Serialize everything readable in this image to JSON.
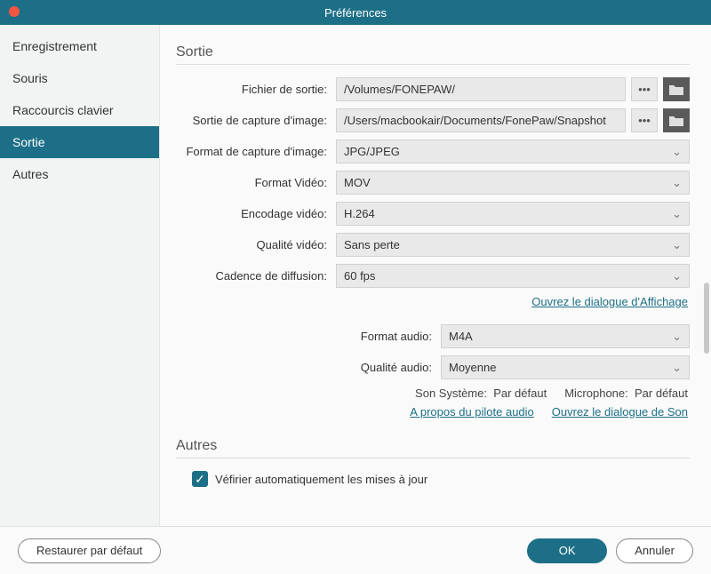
{
  "title": "Préférences",
  "sidebar": {
    "items": [
      {
        "label": "Enregistrement"
      },
      {
        "label": "Souris"
      },
      {
        "label": "Raccourcis clavier"
      },
      {
        "label": "Sortie",
        "active": true
      },
      {
        "label": "Autres"
      }
    ]
  },
  "sections": {
    "sortie_title": "Sortie",
    "autres_title": "Autres"
  },
  "labels": {
    "fichier_sortie": "Fichier de sortie:",
    "capture_image_sortie": "Sortie de capture d'image:",
    "format_capture": "Format de capture d'image:",
    "format_video": "Format Vidéo:",
    "encodage_video": "Encodage vidéo:",
    "qualite_video": "Qualité vidéo:",
    "cadence": "Cadence de diffusion:",
    "format_audio": "Format audio:",
    "qualite_audio": "Qualité audio:",
    "son_systeme": "Son Système:",
    "microphone": "Microphone:"
  },
  "values": {
    "fichier_sortie": "/Volumes/FONEPAW/",
    "capture_image_sortie": "/Users/macbookair/Documents/FonePaw/Snapshot",
    "format_capture": "JPG/JPEG",
    "format_video": "MOV",
    "encodage_video": "H.264",
    "qualite_video": "Sans perte",
    "cadence": "60 fps",
    "format_audio": "M4A",
    "qualite_audio": "Moyenne",
    "son_systeme": "Par défaut",
    "microphone": "Par défaut"
  },
  "links": {
    "ouvrir_affichage": "Ouvrez le dialogue d'Affichage",
    "a_propos_pilote": "A propos du pilote audio",
    "ouvrir_son": "Ouvrez le dialogue de Son"
  },
  "autres": {
    "auto_update_label": "Véfirier automatiquement les mises à jour",
    "auto_update_checked": true
  },
  "footer": {
    "restore": "Restaurer par défaut",
    "ok": "OK",
    "cancel": "Annuler"
  },
  "icons": {
    "more": "•••",
    "folder": "folder",
    "chevron": "⌄",
    "check": "✓"
  }
}
